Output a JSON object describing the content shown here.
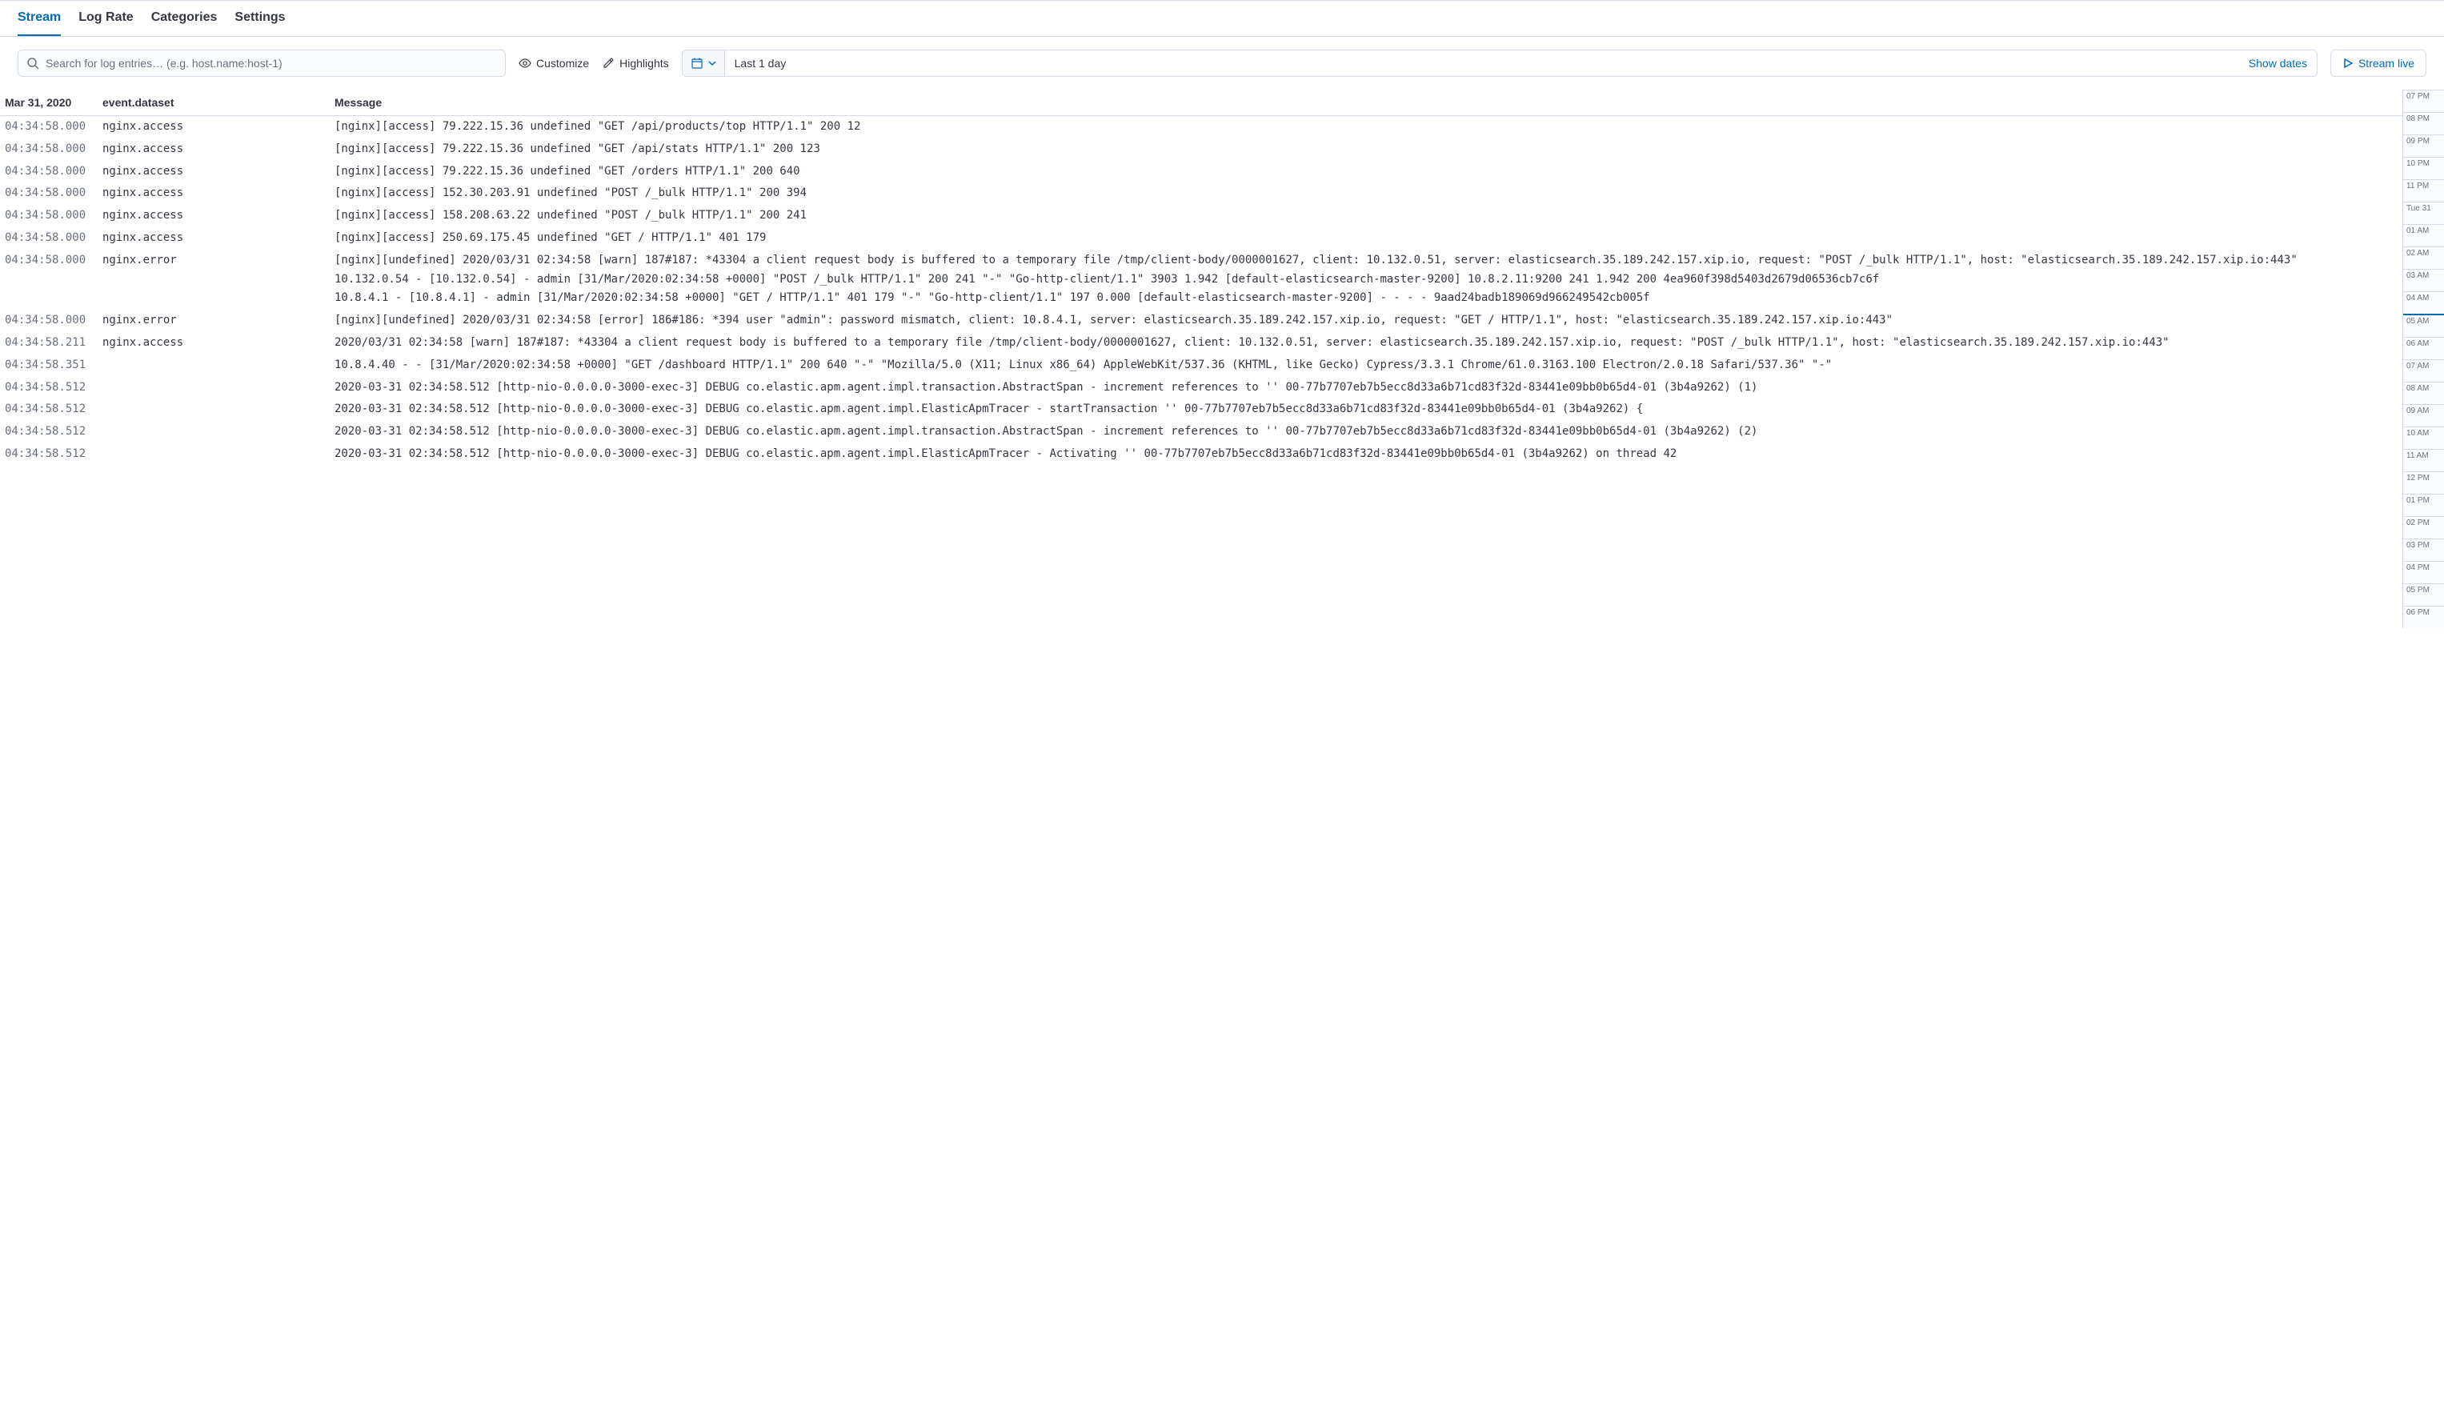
{
  "tabs": {
    "items": [
      {
        "label": "Stream",
        "active": true
      },
      {
        "label": "Log Rate",
        "active": false
      },
      {
        "label": "Categories",
        "active": false
      },
      {
        "label": "Settings",
        "active": false
      }
    ]
  },
  "toolbar": {
    "search_placeholder": "Search for log entries… (e.g. host.name:host-1)",
    "customize_label": "Customize",
    "highlights_label": "Highlights",
    "date_range": "Last 1 day",
    "show_dates_label": "Show dates",
    "stream_live_label": "Stream live"
  },
  "headers": {
    "time": "Mar 31, 2020",
    "dataset": "event.dataset",
    "message": "Message"
  },
  "logs": [
    {
      "time": "04:34:58.000",
      "dataset": "nginx.access",
      "message": "[nginx][access] 79.222.15.36 undefined \"GET /api/products/top HTTP/1.1\" 200 12"
    },
    {
      "time": "04:34:58.000",
      "dataset": "nginx.access",
      "message": "[nginx][access] 79.222.15.36 undefined \"GET /api/stats HTTP/1.1\" 200 123"
    },
    {
      "time": "04:34:58.000",
      "dataset": "nginx.access",
      "message": "[nginx][access] 79.222.15.36 undefined \"GET /orders HTTP/1.1\" 200 640"
    },
    {
      "time": "04:34:58.000",
      "dataset": "nginx.access",
      "message": "[nginx][access] 152.30.203.91 undefined \"POST /_bulk HTTP/1.1\" 200 394"
    },
    {
      "time": "04:34:58.000",
      "dataset": "nginx.access",
      "message": "[nginx][access] 158.208.63.22 undefined \"POST /_bulk HTTP/1.1\" 200 241"
    },
    {
      "time": "04:34:58.000",
      "dataset": "nginx.access",
      "message": "[nginx][access] 250.69.175.45 undefined \"GET / HTTP/1.1\" 401 179"
    },
    {
      "time": "04:34:58.000",
      "dataset": "nginx.error",
      "message": "[nginx][undefined] 2020/03/31 02:34:58 [warn] 187#187: *43304 a client request body is buffered to a temporary file /tmp/client-body/0000001627, client: 10.132.0.51, server: elasticsearch.35.189.242.157.xip.io, request: \"POST /_bulk HTTP/1.1\", host: \"elasticsearch.35.189.242.157.xip.io:443\"\n10.132.0.54 - [10.132.0.54] - admin [31/Mar/2020:02:34:58 +0000] \"POST /_bulk HTTP/1.1\" 200 241 \"-\" \"Go-http-client/1.1\" 3903 1.942 [default-elasticsearch-master-9200] 10.8.2.11:9200 241 1.942 200 4ea960f398d5403d2679d06536cb7c6f\n10.8.4.1 - [10.8.4.1] - admin [31/Mar/2020:02:34:58 +0000] \"GET / HTTP/1.1\" 401 179 \"-\" \"Go-http-client/1.1\" 197 0.000 [default-elasticsearch-master-9200] - - - - 9aad24badb189069d966249542cb005f"
    },
    {
      "time": "04:34:58.000",
      "dataset": "nginx.error",
      "message": "[nginx][undefined] 2020/03/31 02:34:58 [error] 186#186: *394 user \"admin\": password mismatch, client: 10.8.4.1, server: elasticsearch.35.189.242.157.xip.io, request: \"GET / HTTP/1.1\", host: \"elasticsearch.35.189.242.157.xip.io:443\""
    },
    {
      "time": "04:34:58.211",
      "dataset": "nginx.access",
      "message": "2020/03/31 02:34:58 [warn] 187#187: *43304 a client request body is buffered to a temporary file /tmp/client-body/0000001627, client: 10.132.0.51, server: elasticsearch.35.189.242.157.xip.io, request: \"POST /_bulk HTTP/1.1\", host: \"elasticsearch.35.189.242.157.xip.io:443\""
    },
    {
      "time": "04:34:58.351",
      "dataset": "",
      "message": "10.8.4.40 - - [31/Mar/2020:02:34:58 +0000] \"GET /dashboard HTTP/1.1\" 200 640 \"-\" \"Mozilla/5.0 (X11; Linux x86_64) AppleWebKit/537.36 (KHTML, like Gecko) Cypress/3.3.1 Chrome/61.0.3163.100 Electron/2.0.18 Safari/537.36\" \"-\""
    },
    {
      "time": "04:34:58.512",
      "dataset": "",
      "message": "2020-03-31 02:34:58.512 [http-nio-0.0.0.0-3000-exec-3] DEBUG co.elastic.apm.agent.impl.transaction.AbstractSpan - increment references to '' 00-77b7707eb7b5ecc8d33a6b71cd83f32d-83441e09bb0b65d4-01 (3b4a9262) (1)"
    },
    {
      "time": "04:34:58.512",
      "dataset": "",
      "message": "2020-03-31 02:34:58.512 [http-nio-0.0.0.0-3000-exec-3] DEBUG co.elastic.apm.agent.impl.ElasticApmTracer - startTransaction '' 00-77b7707eb7b5ecc8d33a6b71cd83f32d-83441e09bb0b65d4-01 (3b4a9262) {"
    },
    {
      "time": "04:34:58.512",
      "dataset": "",
      "message": "2020-03-31 02:34:58.512 [http-nio-0.0.0.0-3000-exec-3] DEBUG co.elastic.apm.agent.impl.transaction.AbstractSpan - increment references to '' 00-77b7707eb7b5ecc8d33a6b71cd83f32d-83441e09bb0b65d4-01 (3b4a9262) (2)"
    },
    {
      "time": "04:34:58.512",
      "dataset": "",
      "message": "2020-03-31 02:34:58.512 [http-nio-0.0.0.0-3000-exec-3] DEBUG co.elastic.apm.agent.impl.ElasticApmTracer - Activating '' 00-77b7707eb7b5ecc8d33a6b71cd83f32d-83441e09bb0b65d4-01 (3b4a9262) on thread 42"
    }
  ],
  "minimap": {
    "ticks": [
      {
        "label": "07 PM",
        "marked": false
      },
      {
        "label": "08 PM",
        "marked": false
      },
      {
        "label": "09 PM",
        "marked": false
      },
      {
        "label": "10 PM",
        "marked": false
      },
      {
        "label": "11 PM",
        "marked": false
      },
      {
        "label": "Tue 31",
        "marked": false
      },
      {
        "label": "01 AM",
        "marked": false
      },
      {
        "label": "02 AM",
        "marked": false
      },
      {
        "label": "03 AM",
        "marked": false
      },
      {
        "label": "04 AM",
        "marked": false
      },
      {
        "label": "05 AM",
        "marked": true
      },
      {
        "label": "06 AM",
        "marked": false
      },
      {
        "label": "07 AM",
        "marked": false
      },
      {
        "label": "08 AM",
        "marked": false
      },
      {
        "label": "09 AM",
        "marked": false
      },
      {
        "label": "10 AM",
        "marked": false
      },
      {
        "label": "11 AM",
        "marked": false
      },
      {
        "label": "12 PM",
        "marked": false
      },
      {
        "label": "01 PM",
        "marked": false
      },
      {
        "label": "02 PM",
        "marked": false
      },
      {
        "label": "03 PM",
        "marked": false
      },
      {
        "label": "04 PM",
        "marked": false
      },
      {
        "label": "05 PM",
        "marked": false
      },
      {
        "label": "06 PM",
        "marked": false
      }
    ]
  }
}
